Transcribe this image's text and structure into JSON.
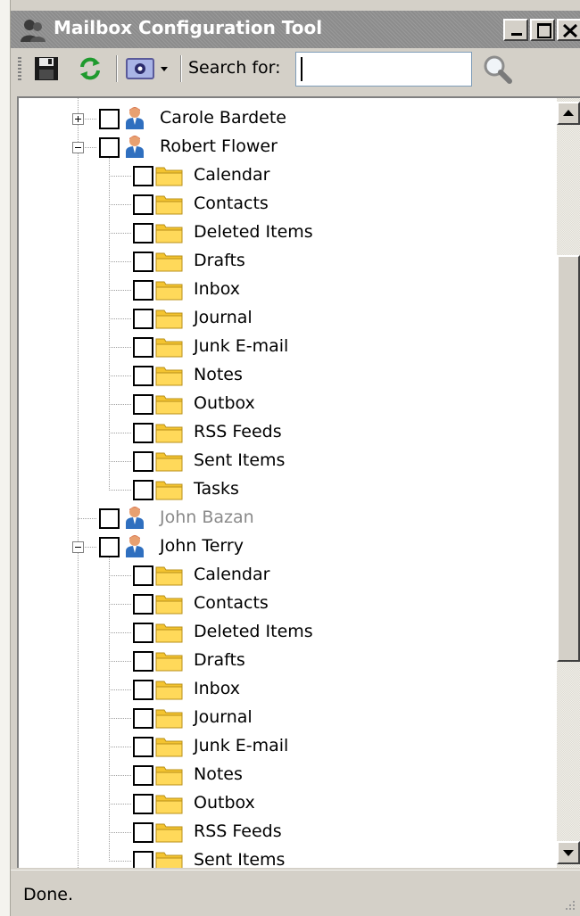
{
  "window": {
    "title": "Mailbox Configuration Tool",
    "icon": "users-icon"
  },
  "toolbar": {
    "search_label": "Search for:",
    "search_value": "",
    "buttons": [
      "save-icon",
      "refresh-icon",
      "settings-dropdown-icon",
      "search-icon"
    ]
  },
  "tree": {
    "rows": [
      {
        "label": "Carole Bardete",
        "type": "mailbox",
        "expander": "collapsed",
        "state": "normal"
      },
      {
        "label": "Robert Flower",
        "type": "mailbox",
        "expander": "expanded",
        "state": "normal"
      },
      {
        "label": "Calendar",
        "type": "folder"
      },
      {
        "label": "Contacts",
        "type": "folder"
      },
      {
        "label": "Deleted Items",
        "type": "folder"
      },
      {
        "label": "Drafts",
        "type": "folder"
      },
      {
        "label": "Inbox",
        "type": "folder"
      },
      {
        "label": "Journal",
        "type": "folder"
      },
      {
        "label": "Junk E-mail",
        "type": "folder"
      },
      {
        "label": "Notes",
        "type": "folder"
      },
      {
        "label": "Outbox",
        "type": "folder"
      },
      {
        "label": "RSS Feeds",
        "type": "folder"
      },
      {
        "label": "Sent Items",
        "type": "folder"
      },
      {
        "label": "Tasks",
        "type": "folder"
      },
      {
        "label": "John Bazan",
        "type": "mailbox",
        "expander": "none",
        "state": "disabled"
      },
      {
        "label": "John Terry",
        "type": "mailbox",
        "expander": "expanded",
        "state": "normal"
      },
      {
        "label": "Calendar",
        "type": "folder"
      },
      {
        "label": "Contacts",
        "type": "folder"
      },
      {
        "label": "Deleted Items",
        "type": "folder"
      },
      {
        "label": "Drafts",
        "type": "folder"
      },
      {
        "label": "Inbox",
        "type": "folder"
      },
      {
        "label": "Journal",
        "type": "folder"
      },
      {
        "label": "Junk E-mail",
        "type": "folder"
      },
      {
        "label": "Notes",
        "type": "folder"
      },
      {
        "label": "Outbox",
        "type": "folder"
      },
      {
        "label": "RSS Feeds",
        "type": "folder"
      },
      {
        "label": "Sent Items",
        "type": "folder"
      }
    ]
  },
  "status": {
    "text": "Done."
  },
  "colors": {
    "chrome": "#d4d0c8",
    "title_bar": "#8c8c8c",
    "folder_yellow": "#f4c430",
    "user_blue": "#2f6fbf",
    "user_skin": "#e8a070",
    "disabled_text": "#8a8a8a"
  }
}
